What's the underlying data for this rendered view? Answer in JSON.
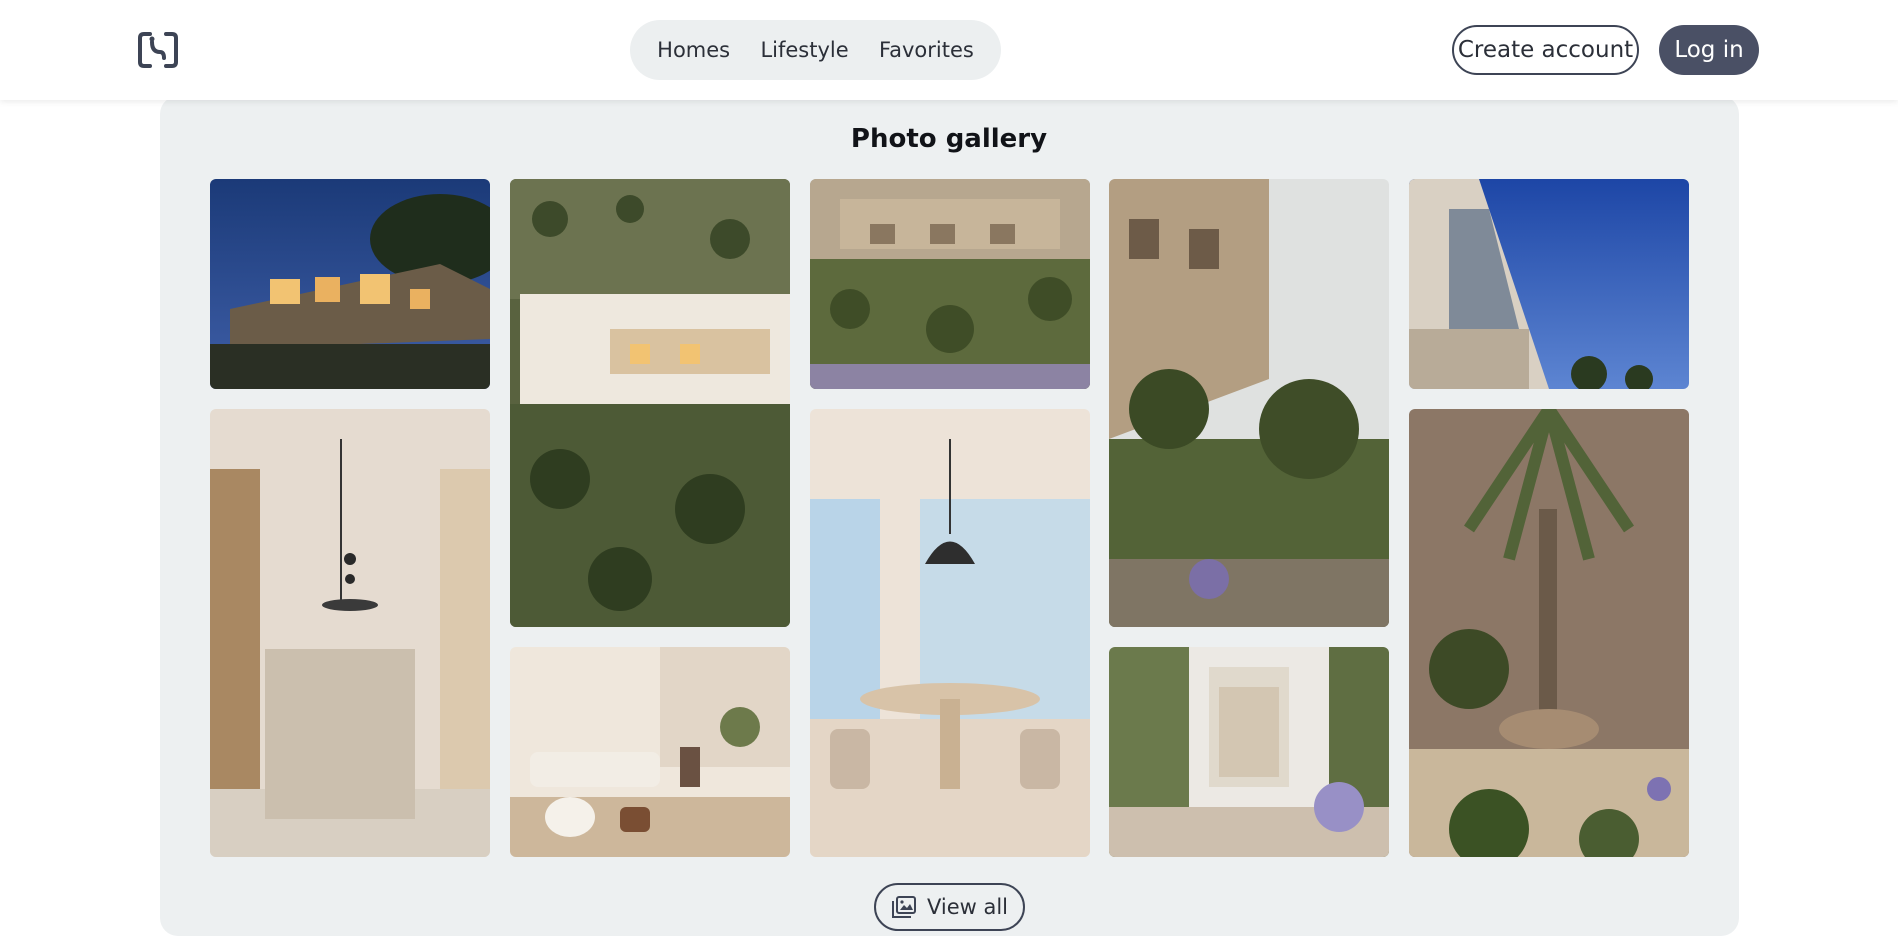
{
  "header": {
    "logo_icon": "bracket-logo-icon",
    "nav": [
      {
        "label": "Homes"
      },
      {
        "label": "Lifestyle"
      },
      {
        "label": "Favorites"
      }
    ],
    "create_account_label": "Create account",
    "login_label": "Log in"
  },
  "gallery": {
    "title": "Photo gallery",
    "view_all_label": "View all",
    "view_all_icon": "gallery-icon",
    "photos": [
      {
        "subject": "villa-night-exterior"
      },
      {
        "subject": "villa-hillside-aerial"
      },
      {
        "subject": "villa-terraced-garden"
      },
      {
        "subject": "villa-facade-garden"
      },
      {
        "subject": "villa-sky-corner"
      },
      {
        "subject": "kitchen-island"
      },
      {
        "subject": "living-room"
      },
      {
        "subject": "dining-room"
      },
      {
        "subject": "courtyard-plants"
      },
      {
        "subject": "garden-palms-rocks"
      }
    ]
  },
  "colors": {
    "accent": "#4a5065",
    "panel": "#edf0f1",
    "nav_pill": "#eceff0"
  }
}
